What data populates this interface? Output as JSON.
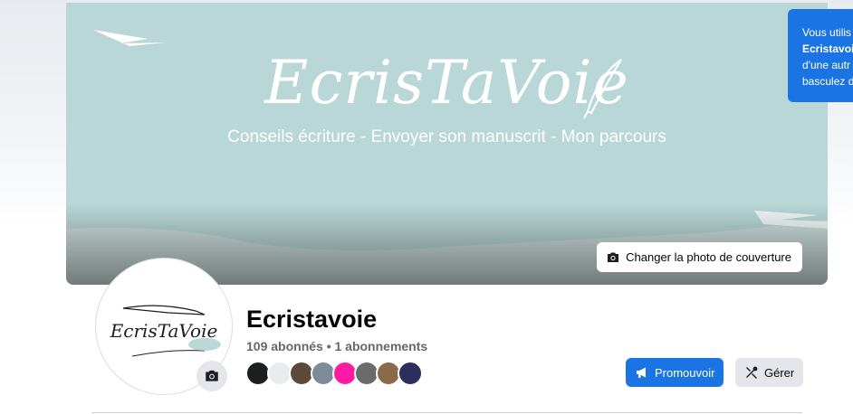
{
  "cover": {
    "title": "EcrisTaVoie",
    "subtitle": "Conseils écriture - Envoyer son manuscrit - Mon parcours",
    "change_cover_label": "Changer la photo de couverture"
  },
  "profile": {
    "avatar_text": "EcrisTaVoie",
    "name": "Ecristavoie",
    "stats": "109 abonnés • 1 abonnements"
  },
  "actions": {
    "promote_label": "Promouvoir",
    "manage_label": "Gérer"
  },
  "tooltip": {
    "line1": "Vous utilis",
    "line2": "Ecristavoi",
    "line3": "d'une autr",
    "line4": "basculez d"
  },
  "follower_avatars": [
    "#1c1e21",
    "#e9ecef",
    "#5b4a3a",
    "#7c8a9a",
    "#ff1aa3",
    "#6b6b6b",
    "#8a6a4a",
    "#2b2f5a"
  ],
  "colors": {
    "cover_bg": "#b8d7d6",
    "primary": "#1b74e4",
    "secondary_btn": "#e4e6eb"
  }
}
